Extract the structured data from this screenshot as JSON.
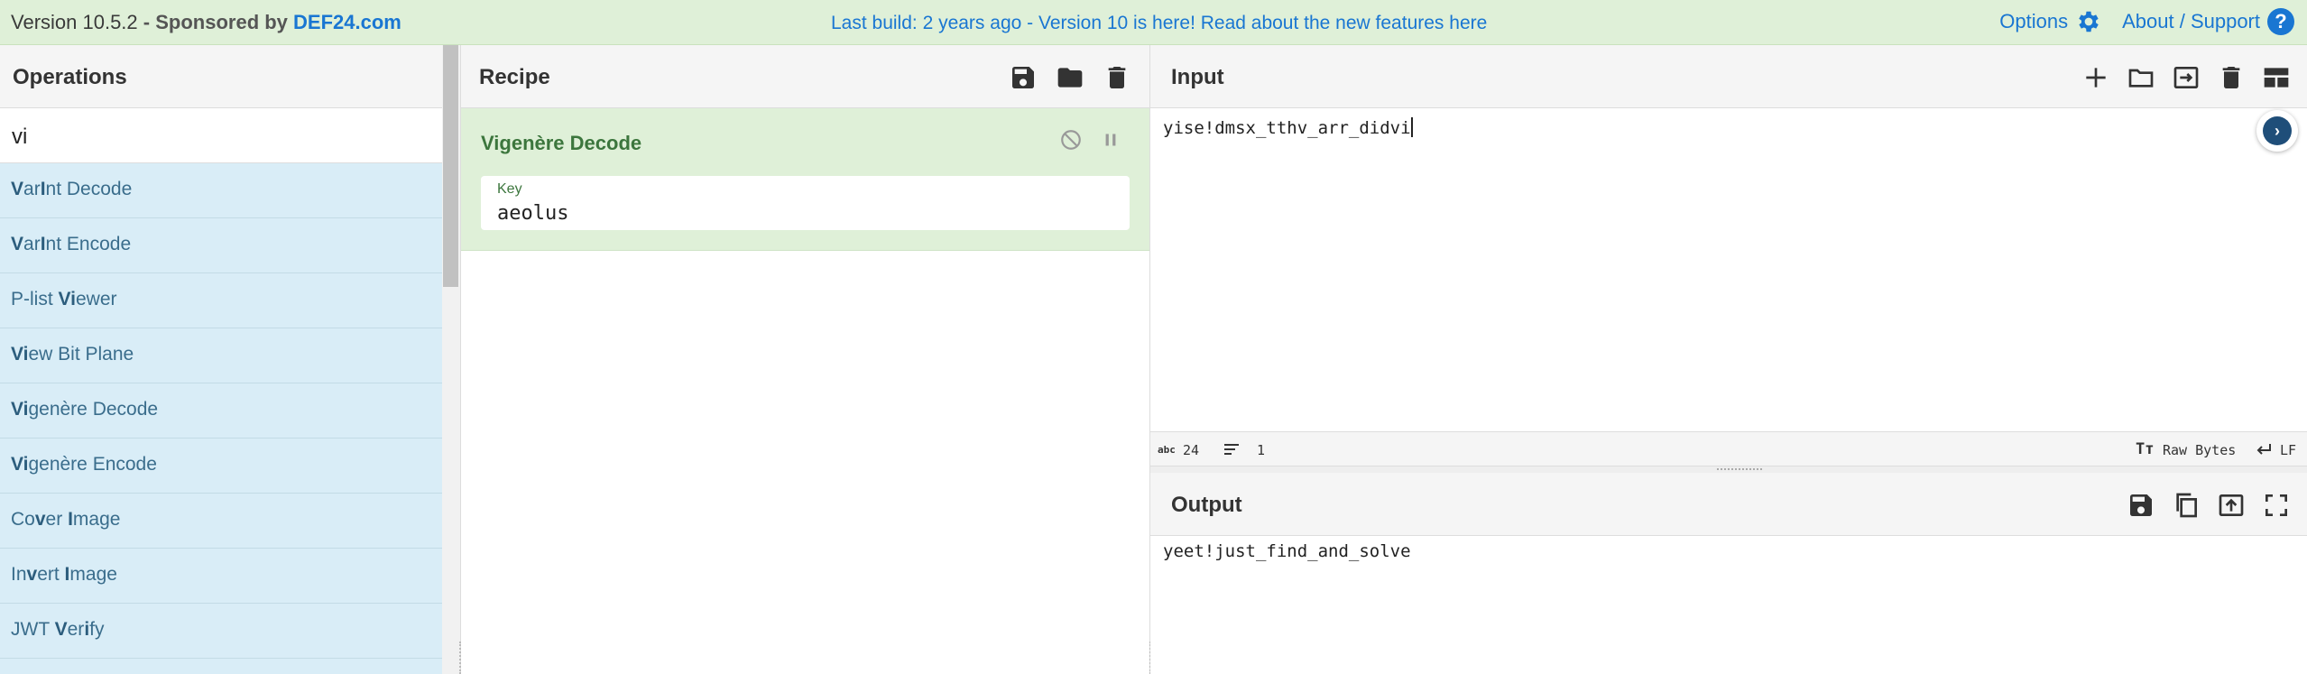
{
  "banner": {
    "version": "Version 10.5.2",
    "sponsored": "- Sponsored by",
    "sponsor": "DEF24.com",
    "message": "Last build: 2 years ago - Version 10 is here! Read about the new features here",
    "options": "Options",
    "about": "About / Support",
    "help_glyph": "?"
  },
  "operations": {
    "title": "Operations",
    "search_value": "vi",
    "items": [
      {
        "bold": "V",
        "rest": "arInt Decode",
        "parts": [
          "V",
          "ar",
          "I",
          "nt Decode"
        ]
      },
      {
        "bold": "V",
        "rest": "arInt Encode",
        "parts": [
          "V",
          "ar",
          "I",
          "nt Encode"
        ]
      },
      {
        "parts": [
          "P-list ",
          "Vi",
          "ewer",
          ""
        ]
      },
      {
        "parts": [
          "Vi",
          "ew Bit Plane",
          "",
          ""
        ]
      },
      {
        "parts": [
          "Vi",
          "genère Decode",
          "",
          ""
        ]
      },
      {
        "parts": [
          "Vi",
          "genère Encode",
          "",
          ""
        ]
      },
      {
        "parts": [
          "Co",
          "v",
          "er ",
          "I",
          "mage"
        ]
      },
      {
        "parts": [
          "In",
          "v",
          "ert ",
          "I",
          "mage"
        ]
      },
      {
        "parts": [
          "JWT ",
          "V",
          "er",
          "i",
          "fy"
        ]
      }
    ]
  },
  "recipe": {
    "title": "Recipe",
    "operation": {
      "name": "Vigenère Decode",
      "key_label": "Key",
      "key_value": "aeolus"
    }
  },
  "input": {
    "title": "Input",
    "text": "yise!dmsx_tthv_arr_didvi",
    "status": {
      "length_icon": "abc",
      "length": "24",
      "lines": "1",
      "encoding_icon": "Tт",
      "encoding": "Raw Bytes",
      "eol": "LF"
    }
  },
  "output": {
    "title": "Output",
    "text": "yeet!just_find_and_solve"
  },
  "colors": {
    "banner_bg": "#dff0d8",
    "link_blue": "#1976d2",
    "op_list_bg": "#d9edf7",
    "recipe_card_bg": "#dff0d8",
    "recipe_text_green": "#3c763d"
  }
}
